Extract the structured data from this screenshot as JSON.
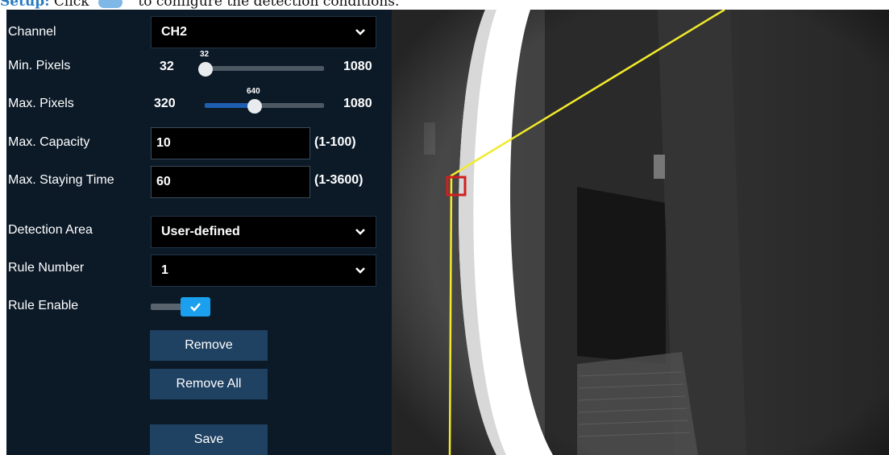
{
  "caption": {
    "prefix": "Setup:",
    "before_icon": "Click",
    "after_icon": "to configure the detection conditions.",
    "icon": "settings-icon"
  },
  "form": {
    "channel": {
      "label": "Channel",
      "value": "CH2"
    },
    "min_pixels": {
      "label": "Min. Pixels",
      "min": "32",
      "max": "1080",
      "value": "32",
      "fraction": 0.0
    },
    "max_pixels": {
      "label": "Max. Pixels",
      "min": "320",
      "max": "1080",
      "value": "640",
      "fraction": 0.42
    },
    "max_capacity": {
      "label": "Max. Capacity",
      "value": "10",
      "range": "(1-100)"
    },
    "max_staying_time": {
      "label": "Max. Staying Time",
      "value": "60",
      "range": "(1-3600)"
    },
    "detection_area": {
      "label": "Detection Area",
      "value": "User-defined"
    },
    "rule_number": {
      "label": "Rule Number",
      "value": "1"
    },
    "rule_enable": {
      "label": "Rule Enable",
      "checked": true
    }
  },
  "buttons": {
    "remove": "Remove",
    "remove_all": "Remove All",
    "save": "Save"
  },
  "colors": {
    "panel_bg": "#0c1a28",
    "accent": "#1aa0ee",
    "button_bg": "#1f4162",
    "rule_line": "#f2ea2a",
    "corner_marker": "#d0201f"
  }
}
